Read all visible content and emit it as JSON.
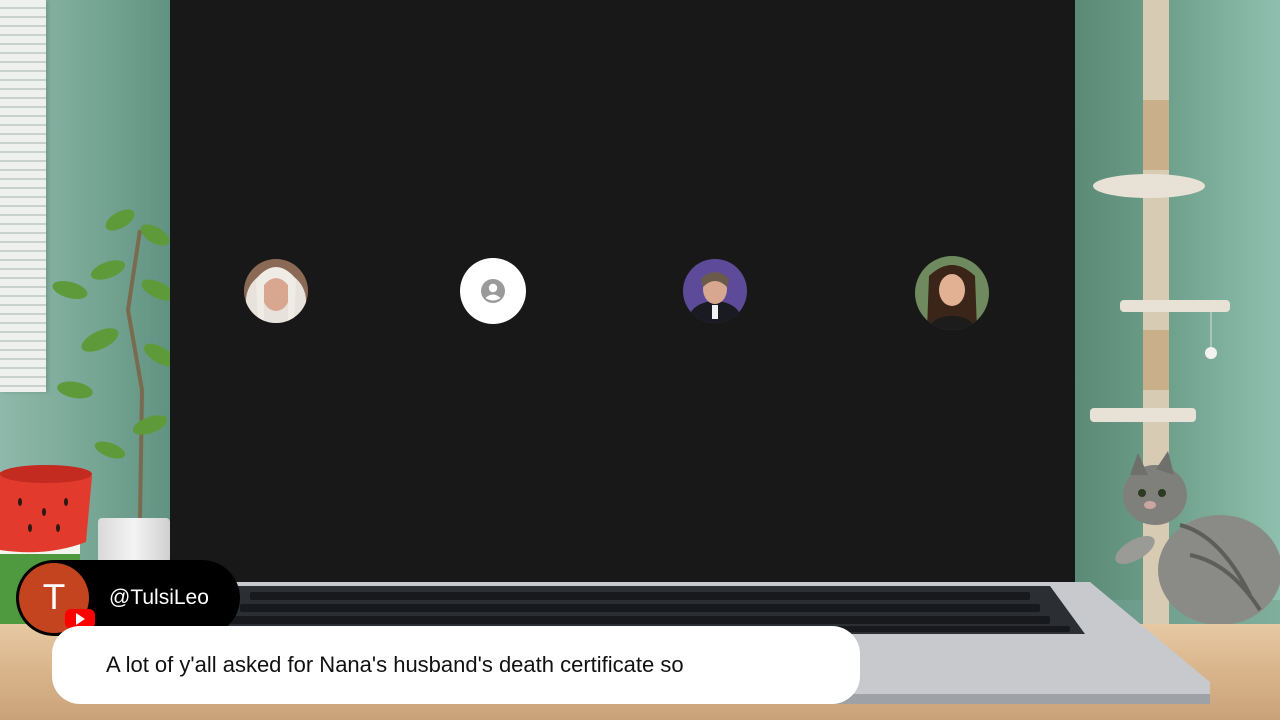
{
  "call": {
    "participants": [
      {
        "name": "participant-1",
        "kind": "photo"
      },
      {
        "name": "participant-2",
        "kind": "placeholder",
        "icon": "account-circle-icon"
      },
      {
        "name": "participant-3",
        "kind": "photo"
      },
      {
        "name": "participant-4",
        "kind": "photo"
      }
    ]
  },
  "creator": {
    "avatar_initial": "T",
    "handle": "@TulsiLeo",
    "badge_icon": "youtube-icon"
  },
  "caption": {
    "text": "A lot of y'all asked for Nana's husband's death certificate so"
  },
  "colors": {
    "screen": "#181818",
    "avatar": "#c54420",
    "youtube_red": "#ff0000"
  }
}
